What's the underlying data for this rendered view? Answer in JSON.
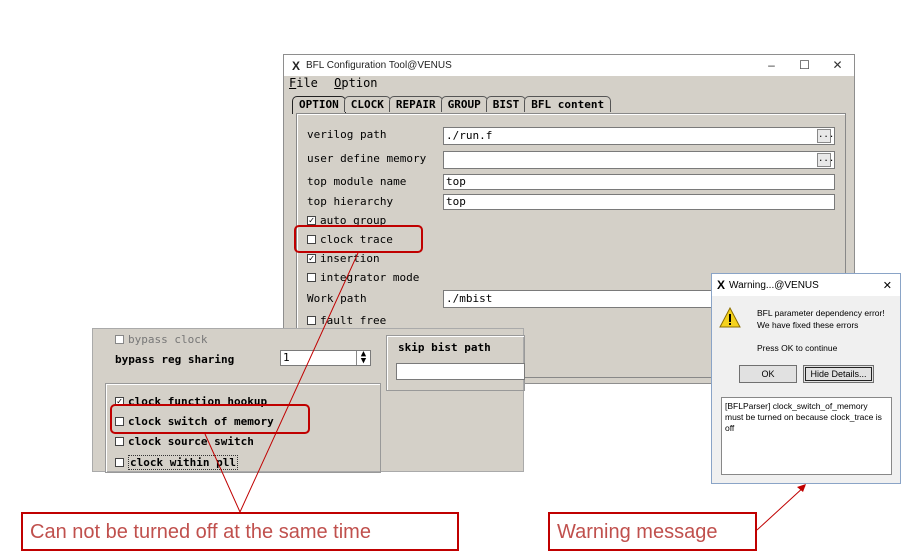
{
  "main_window": {
    "title": "BFL Configuration Tool@VENUS",
    "controls": {
      "minimize": "–",
      "maximize": "☐",
      "close": "✕"
    },
    "menu": [
      {
        "underline": "F",
        "rest": "ile"
      },
      {
        "underline": "O",
        "rest": "ption"
      }
    ],
    "tabs": [
      "OPTION",
      "CLOCK",
      "REPAIR",
      "GROUP",
      "BIST",
      "BFL content"
    ],
    "active_tab": "OPTION",
    "fields": {
      "verilog_path": {
        "label": "verilog path",
        "value": "./run.f"
      },
      "user_define_memory": {
        "label": "user define memory",
        "value": ""
      },
      "top_module_name": {
        "label": "top module name",
        "value": "top"
      },
      "top_hierarchy": {
        "label": "top hierarchy",
        "value": "top"
      },
      "work_path": {
        "label": "Work path",
        "value": "./mbist"
      }
    },
    "browse_label": "...",
    "checkboxes": {
      "auto_group": {
        "label": "auto group",
        "checked": true
      },
      "clock_trace": {
        "label": "clock trace",
        "checked": false
      },
      "insertion": {
        "label": "insertion",
        "checked": true
      },
      "integrator_mode": {
        "label": "integrator mode",
        "checked": false
      },
      "fault_free": {
        "label": "fault free",
        "checked": false
      }
    }
  },
  "inset_panel": {
    "bypass_clock": {
      "label": "bypass clock",
      "checked": false
    },
    "bypass_reg_sharing": {
      "label": "bypass reg sharing",
      "value": "1"
    },
    "skip_bist_path": {
      "label": "skip bist path",
      "value": ""
    },
    "clock_function_hookup": {
      "label": "clock function hookup",
      "checked": true
    },
    "clock_switch_of_memory": {
      "label": "clock switch of memory",
      "checked": false
    },
    "clock_source_switch": {
      "label": "clock source switch",
      "checked": false
    },
    "clock_within_pll": {
      "label": "clock within pll",
      "checked": false
    }
  },
  "warning_dialog": {
    "title": "Warning...@VENUS",
    "close": "✕",
    "message_line1": "BFL parameter dependency error!",
    "message_line2": "We have fixed these errors",
    "prompt": "Press OK to continue",
    "ok_button": "OK",
    "hide_details_button": "Hide Details...",
    "details": "[BFLParser] clock_switch_of_memory must be turned on because clock_trace is off"
  },
  "annotations": {
    "left_callout": "Can not be turned off at the same time",
    "right_callout": "Warning message",
    "highlight_color": "#c00000"
  }
}
